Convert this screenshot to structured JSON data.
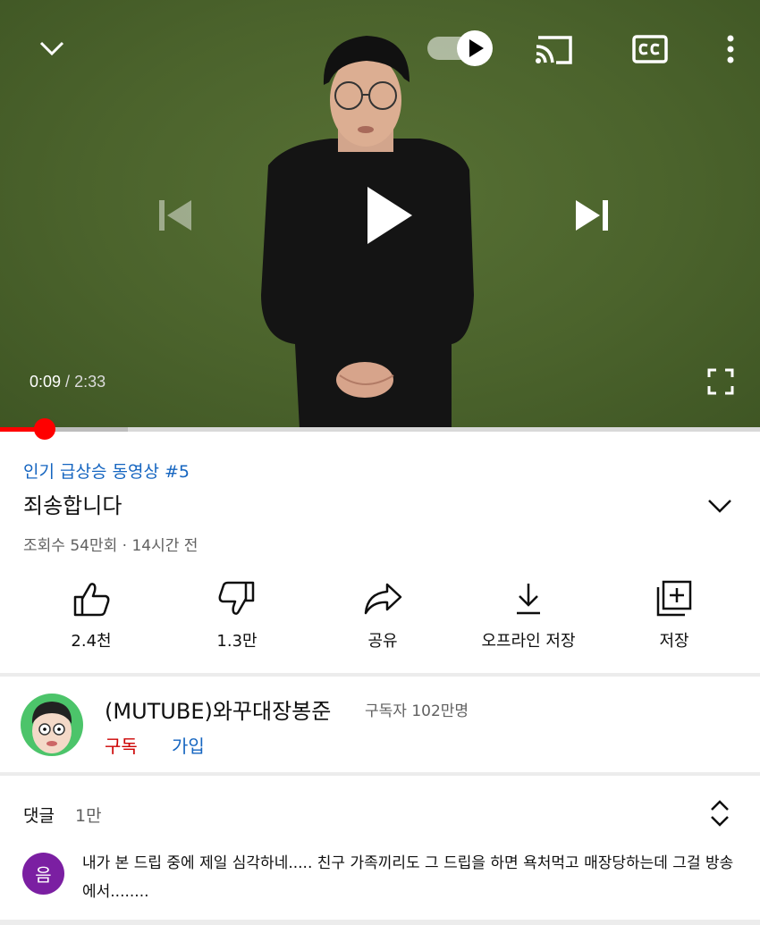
{
  "player": {
    "current_time": "0:09",
    "separator": " / ",
    "duration": "2:33",
    "progress_fraction": 0.059,
    "buffered_fraction": 0.168
  },
  "colors": {
    "video_bg": "#4b632c",
    "progress": "#ff0000",
    "link_blue": "#1565c0",
    "subscribe_red": "#cc0000",
    "comment_avatar": "#7b1fa2",
    "channel_avatar": "#4cc46a"
  },
  "icons": {
    "collapse": "chevron-down-icon",
    "autoplay": "autoplay-toggle-icon",
    "cast": "cast-icon",
    "captions": "cc-icon",
    "more": "more-vert-icon",
    "previous": "skip-previous-icon",
    "play": "play-icon",
    "next": "skip-next-icon",
    "fullscreen": "fullscreen-icon"
  },
  "video": {
    "trending": "인기 급상승 동영상 #5",
    "title": "죄송합니다",
    "meta": "조회수 54만회 · 14시간 전"
  },
  "actions": [
    {
      "label": "2.4천",
      "icon": "thumbs-up-icon"
    },
    {
      "label": "1.3만",
      "icon": "thumbs-down-icon"
    },
    {
      "label": "공유",
      "icon": "share-icon"
    },
    {
      "label": "오프라인 저장",
      "icon": "download-icon"
    },
    {
      "label": "저장",
      "icon": "add-to-playlist-icon"
    }
  ],
  "channel": {
    "name": "(MUTUBE)와꾸대장봉준",
    "subscribers": "구독자 102만명",
    "subscribe_label": "구독",
    "join_label": "가입"
  },
  "comments": {
    "label": "댓글",
    "count": "1만",
    "first": {
      "avatar_letter": "음",
      "text": "내가 본 드립 중에 제일 심각하네..... 친구 가족끼리도 그 드립을 하면 욕처먹고 매장당하는데 그걸 방송에서........"
    }
  }
}
